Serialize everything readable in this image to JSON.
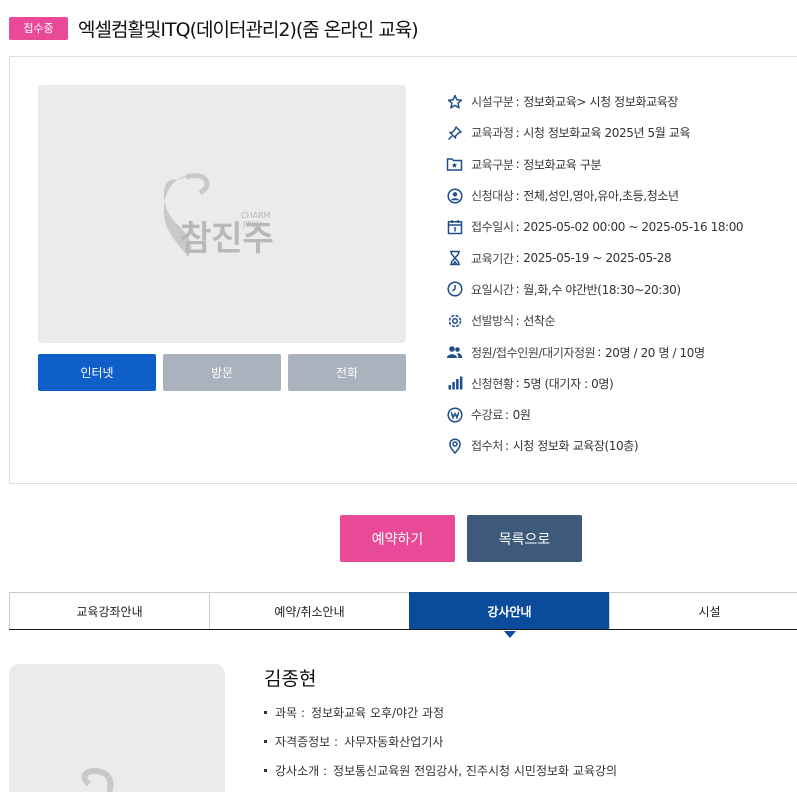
{
  "header": {
    "status_badge": "접수중",
    "title": "엑셀컴활및ITQ(데이터관리2)(줌 온라인 교육)"
  },
  "thumbnail": {
    "logo_text_main": "참진주",
    "logo_text_sub1": "CHARM",
    "logo_text_sub2": "JINJU"
  },
  "methods": [
    {
      "label": "인터넷",
      "active": true
    },
    {
      "label": "방문",
      "active": false
    },
    {
      "label": "전화",
      "active": false
    }
  ],
  "info": [
    {
      "icon": "star-icon",
      "label": "시설구분",
      "value": "정보화교육> 시청 정보화교육장"
    },
    {
      "icon": "pin-icon",
      "label": "교육과정",
      "value": "시청 정보화교육 2025년 5월 교육"
    },
    {
      "icon": "folder-star-icon",
      "label": "교육구분",
      "value": "정보화교육 구분"
    },
    {
      "icon": "user-circle-icon",
      "label": "신청대상",
      "value": "전체,성인,영아,유아,초등,청소년"
    },
    {
      "icon": "calendar-icon",
      "label": "접수일시",
      "value": "2025-05-02 00:00 ~ 2025-05-16 18:00"
    },
    {
      "icon": "hourglass-icon",
      "label": "교육기간",
      "value": "2025-05-19 ~ 2025-05-28"
    },
    {
      "icon": "clock-icon",
      "label": "요일시간",
      "value": "월,화,수 야간반(18:30~20:30)"
    },
    {
      "icon": "gear-icon",
      "label": "선발방식",
      "value": "선착순"
    },
    {
      "icon": "users-icon",
      "label": "정원/접수인원/대기자정원",
      "value": "20명 / 20 명 / 10명"
    },
    {
      "icon": "bar-chart-icon",
      "label": "신청현황",
      "value": "5명 (대기자 : 0명)"
    },
    {
      "icon": "won-icon",
      "label": "수강료",
      "value": "0원"
    },
    {
      "icon": "location-icon",
      "label": "접수처",
      "value": "시청 정보화 교육장(10층)"
    }
  ],
  "actions": {
    "reserve": "예약하기",
    "list": "목록으로"
  },
  "tabs": [
    {
      "label": "교육강좌안내",
      "active": false
    },
    {
      "label": "예약/취소안내",
      "active": false
    },
    {
      "label": "강사안내",
      "active": true
    },
    {
      "label": "시설",
      "active": false
    }
  ],
  "instructor": {
    "name": "김종현",
    "rows": [
      {
        "key": "과목 :",
        "value": "정보화교육 오후/야간 과정"
      },
      {
        "key": "자격증정보 :",
        "value": "사무자동화산업기사"
      },
      {
        "key": "강사소개 :",
        "value": "정보통신교육원 전임강사, 진주시청 시민정보화 교육강의"
      }
    ]
  },
  "colors": {
    "accent_pink": "#e84a97",
    "accent_blue": "#0e5fc8",
    "tab_active": "#0a4b9c",
    "list_button": "#3d5a7a",
    "icon_blue": "#1f4e8c"
  }
}
